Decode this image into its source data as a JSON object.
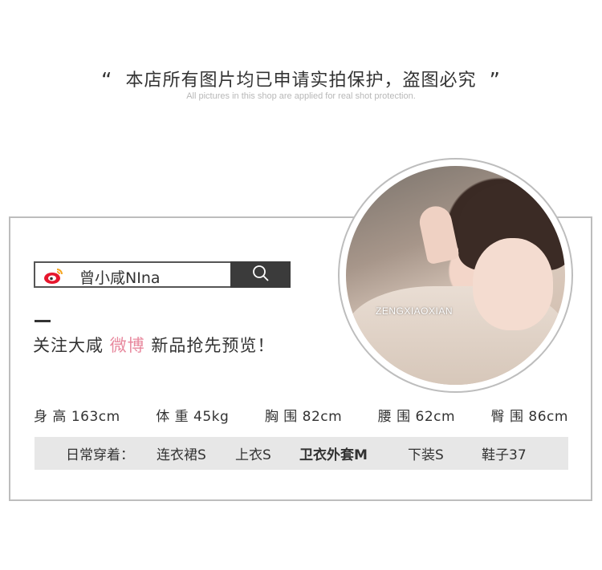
{
  "notice": {
    "open_quote": "“",
    "text": "本店所有图片均已申请实拍保护，盗图必究",
    "close_quote": "”",
    "english": "All pictures in this shop are applied for real shot protection."
  },
  "search": {
    "icon": "weibo-icon",
    "name": "曾小咸NIna",
    "button_icon": "magnifier-icon"
  },
  "avatar": {
    "label": "ZENGXIAOXIAN"
  },
  "follow": {
    "prefix": "关注大咸",
    "highlight": "微博",
    "suffix": "新品抢先预览！",
    "highlight_color": "#e8899e"
  },
  "stats": [
    {
      "label": "身 高",
      "value": "163cm"
    },
    {
      "label": "体 重",
      "value": "45kg"
    },
    {
      "label": "胸 围",
      "value": "82cm"
    },
    {
      "label": "腰 围",
      "value": "62cm"
    },
    {
      "label": "臀 围",
      "value": "86cm"
    }
  ],
  "wear": {
    "title": "日常穿着：",
    "items": [
      "连衣裙S",
      "上衣S",
      "卫衣外套M",
      "下装S",
      "鞋子37"
    ]
  }
}
